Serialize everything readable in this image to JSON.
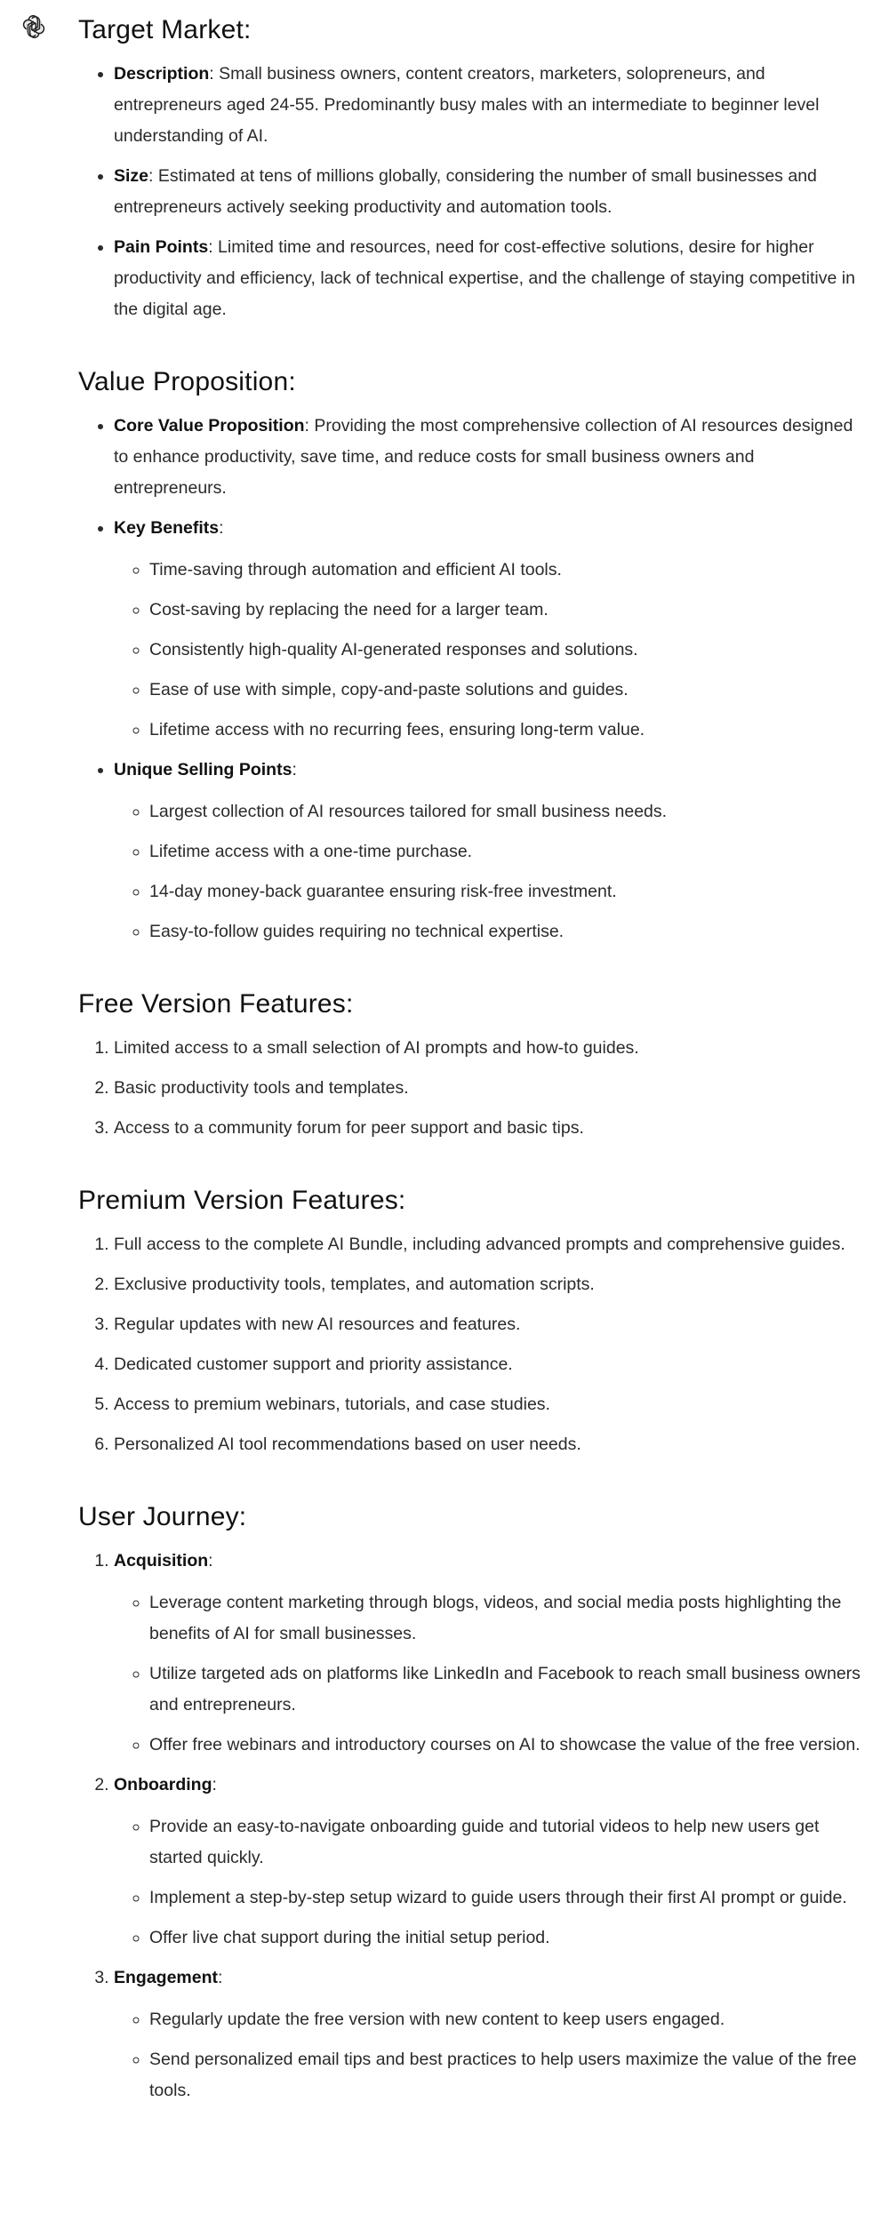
{
  "assistant": {
    "icon": "openai-logo-icon"
  },
  "target_market": {
    "title": "Target Market:",
    "items": [
      {
        "label": "Description",
        "text": ": Small business owners, content creators, marketers, solopreneurs, and entrepreneurs aged 24-55. Predominantly busy males with an intermediate to beginner level understanding of AI."
      },
      {
        "label": "Size",
        "text": ": Estimated at tens of millions globally, considering the number of small businesses and entrepreneurs actively seeking productivity and automation tools."
      },
      {
        "label": "Pain Points",
        "text": ": Limited time and resources, need for cost-effective solutions, desire for higher productivity and efficiency, lack of technical expertise, and the challenge of staying competitive in the digital age."
      }
    ]
  },
  "value_proposition": {
    "title": "Value Proposition:",
    "core": {
      "label": "Core Value Proposition",
      "text": ": Providing the most comprehensive collection of AI resources designed to enhance productivity, save time, and reduce costs for small business owners and entrepreneurs."
    },
    "benefits": {
      "label": "Key Benefits",
      "suffix": ":",
      "items": [
        "Time-saving through automation and efficient AI tools.",
        "Cost-saving by replacing the need for a larger team.",
        "Consistently high-quality AI-generated responses and solutions.",
        "Ease of use with simple, copy-and-paste solutions and guides.",
        "Lifetime access with no recurring fees, ensuring long-term value."
      ]
    },
    "usp": {
      "label": "Unique Selling Points",
      "suffix": ":",
      "items": [
        "Largest collection of AI resources tailored for small business needs.",
        "Lifetime access with a one-time purchase.",
        "14-day money-back guarantee ensuring risk-free investment.",
        "Easy-to-follow guides requiring no technical expertise."
      ]
    }
  },
  "free_version": {
    "title": "Free Version Features:",
    "items": [
      "Limited access to a small selection of AI prompts and how-to guides.",
      "Basic productivity tools and templates.",
      "Access to a community forum for peer support and basic tips."
    ]
  },
  "premium_version": {
    "title": "Premium Version Features:",
    "items": [
      "Full access to the complete AI Bundle, including advanced prompts and comprehensive guides.",
      "Exclusive productivity tools, templates, and automation scripts.",
      "Regular updates with new AI resources and features.",
      "Dedicated customer support and priority assistance.",
      "Access to premium webinars, tutorials, and case studies.",
      "Personalized AI tool recommendations based on user needs."
    ]
  },
  "user_journey": {
    "title": "User Journey:",
    "stages": [
      {
        "label": "Acquisition",
        "suffix": ":",
        "items": [
          "Leverage content marketing through blogs, videos, and social media posts highlighting the benefits of AI for small businesses.",
          "Utilize targeted ads on platforms like LinkedIn and Facebook to reach small business owners and entrepreneurs.",
          "Offer free webinars and introductory courses on AI to showcase the value of the free version."
        ]
      },
      {
        "label": "Onboarding",
        "suffix": ":",
        "items": [
          "Provide an easy-to-navigate onboarding guide and tutorial videos to help new users get started quickly.",
          "Implement a step-by-step setup wizard to guide users through their first AI prompt or guide.",
          "Offer live chat support during the initial setup period."
        ]
      },
      {
        "label": "Engagement",
        "suffix": ":",
        "items": [
          "Regularly update the free version with new content to keep users engaged.",
          "Send personalized email tips and best practices to help users maximize the value of the free tools."
        ]
      }
    ]
  }
}
